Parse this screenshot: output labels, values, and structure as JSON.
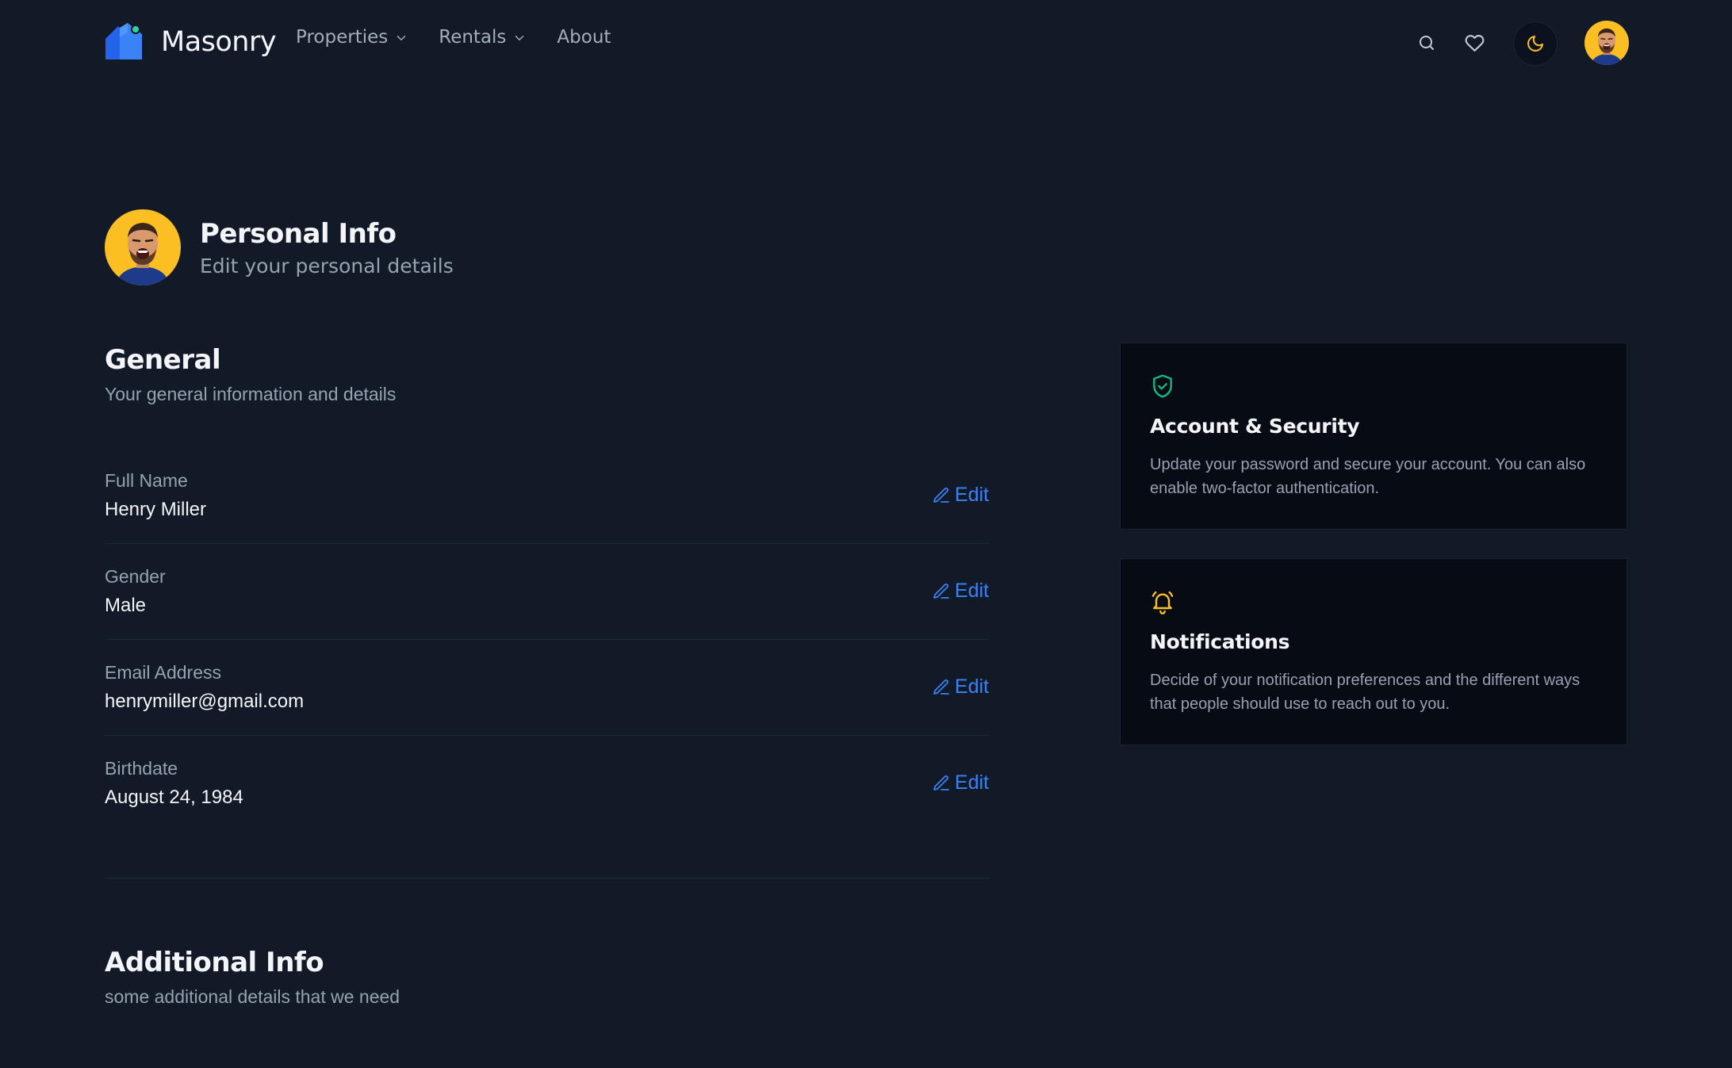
{
  "brand": {
    "name": "Masonry",
    "accent": "#3b82f6"
  },
  "nav": {
    "links": [
      {
        "label": "Properties",
        "has_dropdown": true
      },
      {
        "label": "Rentals",
        "has_dropdown": true
      },
      {
        "label": "About",
        "has_dropdown": false
      }
    ],
    "actions": [
      "search-icon",
      "heart-icon",
      "moon-icon",
      "user-avatar"
    ]
  },
  "profile": {
    "title": "Personal Info",
    "subtitle": "Edit your personal details"
  },
  "general": {
    "title": "General",
    "description": "Your general information and details",
    "fields": [
      {
        "label": "Full Name",
        "value": "Henry Miller",
        "action": "Edit"
      },
      {
        "label": "Gender",
        "value": "Male",
        "action": "Edit"
      },
      {
        "label": "Email Address",
        "value": "henrymiller@gmail.com",
        "action": "Edit"
      },
      {
        "label": "Birthdate",
        "value": "August 24, 1984",
        "action": "Edit"
      }
    ]
  },
  "additional": {
    "title": "Additional Info",
    "description": "some additional details that we need"
  },
  "cards": [
    {
      "icon": "shield-check-icon",
      "icon_color": "#10b981",
      "title": "Account & Security",
      "description": "Update your password and secure your account. You can also enable two-factor authentication."
    },
    {
      "icon": "bell-icon",
      "icon_color": "#fbbf24",
      "title": "Notifications",
      "description": "Decide of your notification preferences and the different ways that people should use to reach out to you."
    }
  ],
  "colors": {
    "background": "#121a28",
    "card_background": "#070b14",
    "link": "#3b82f6",
    "avatar_bg": "#fbbf24"
  }
}
